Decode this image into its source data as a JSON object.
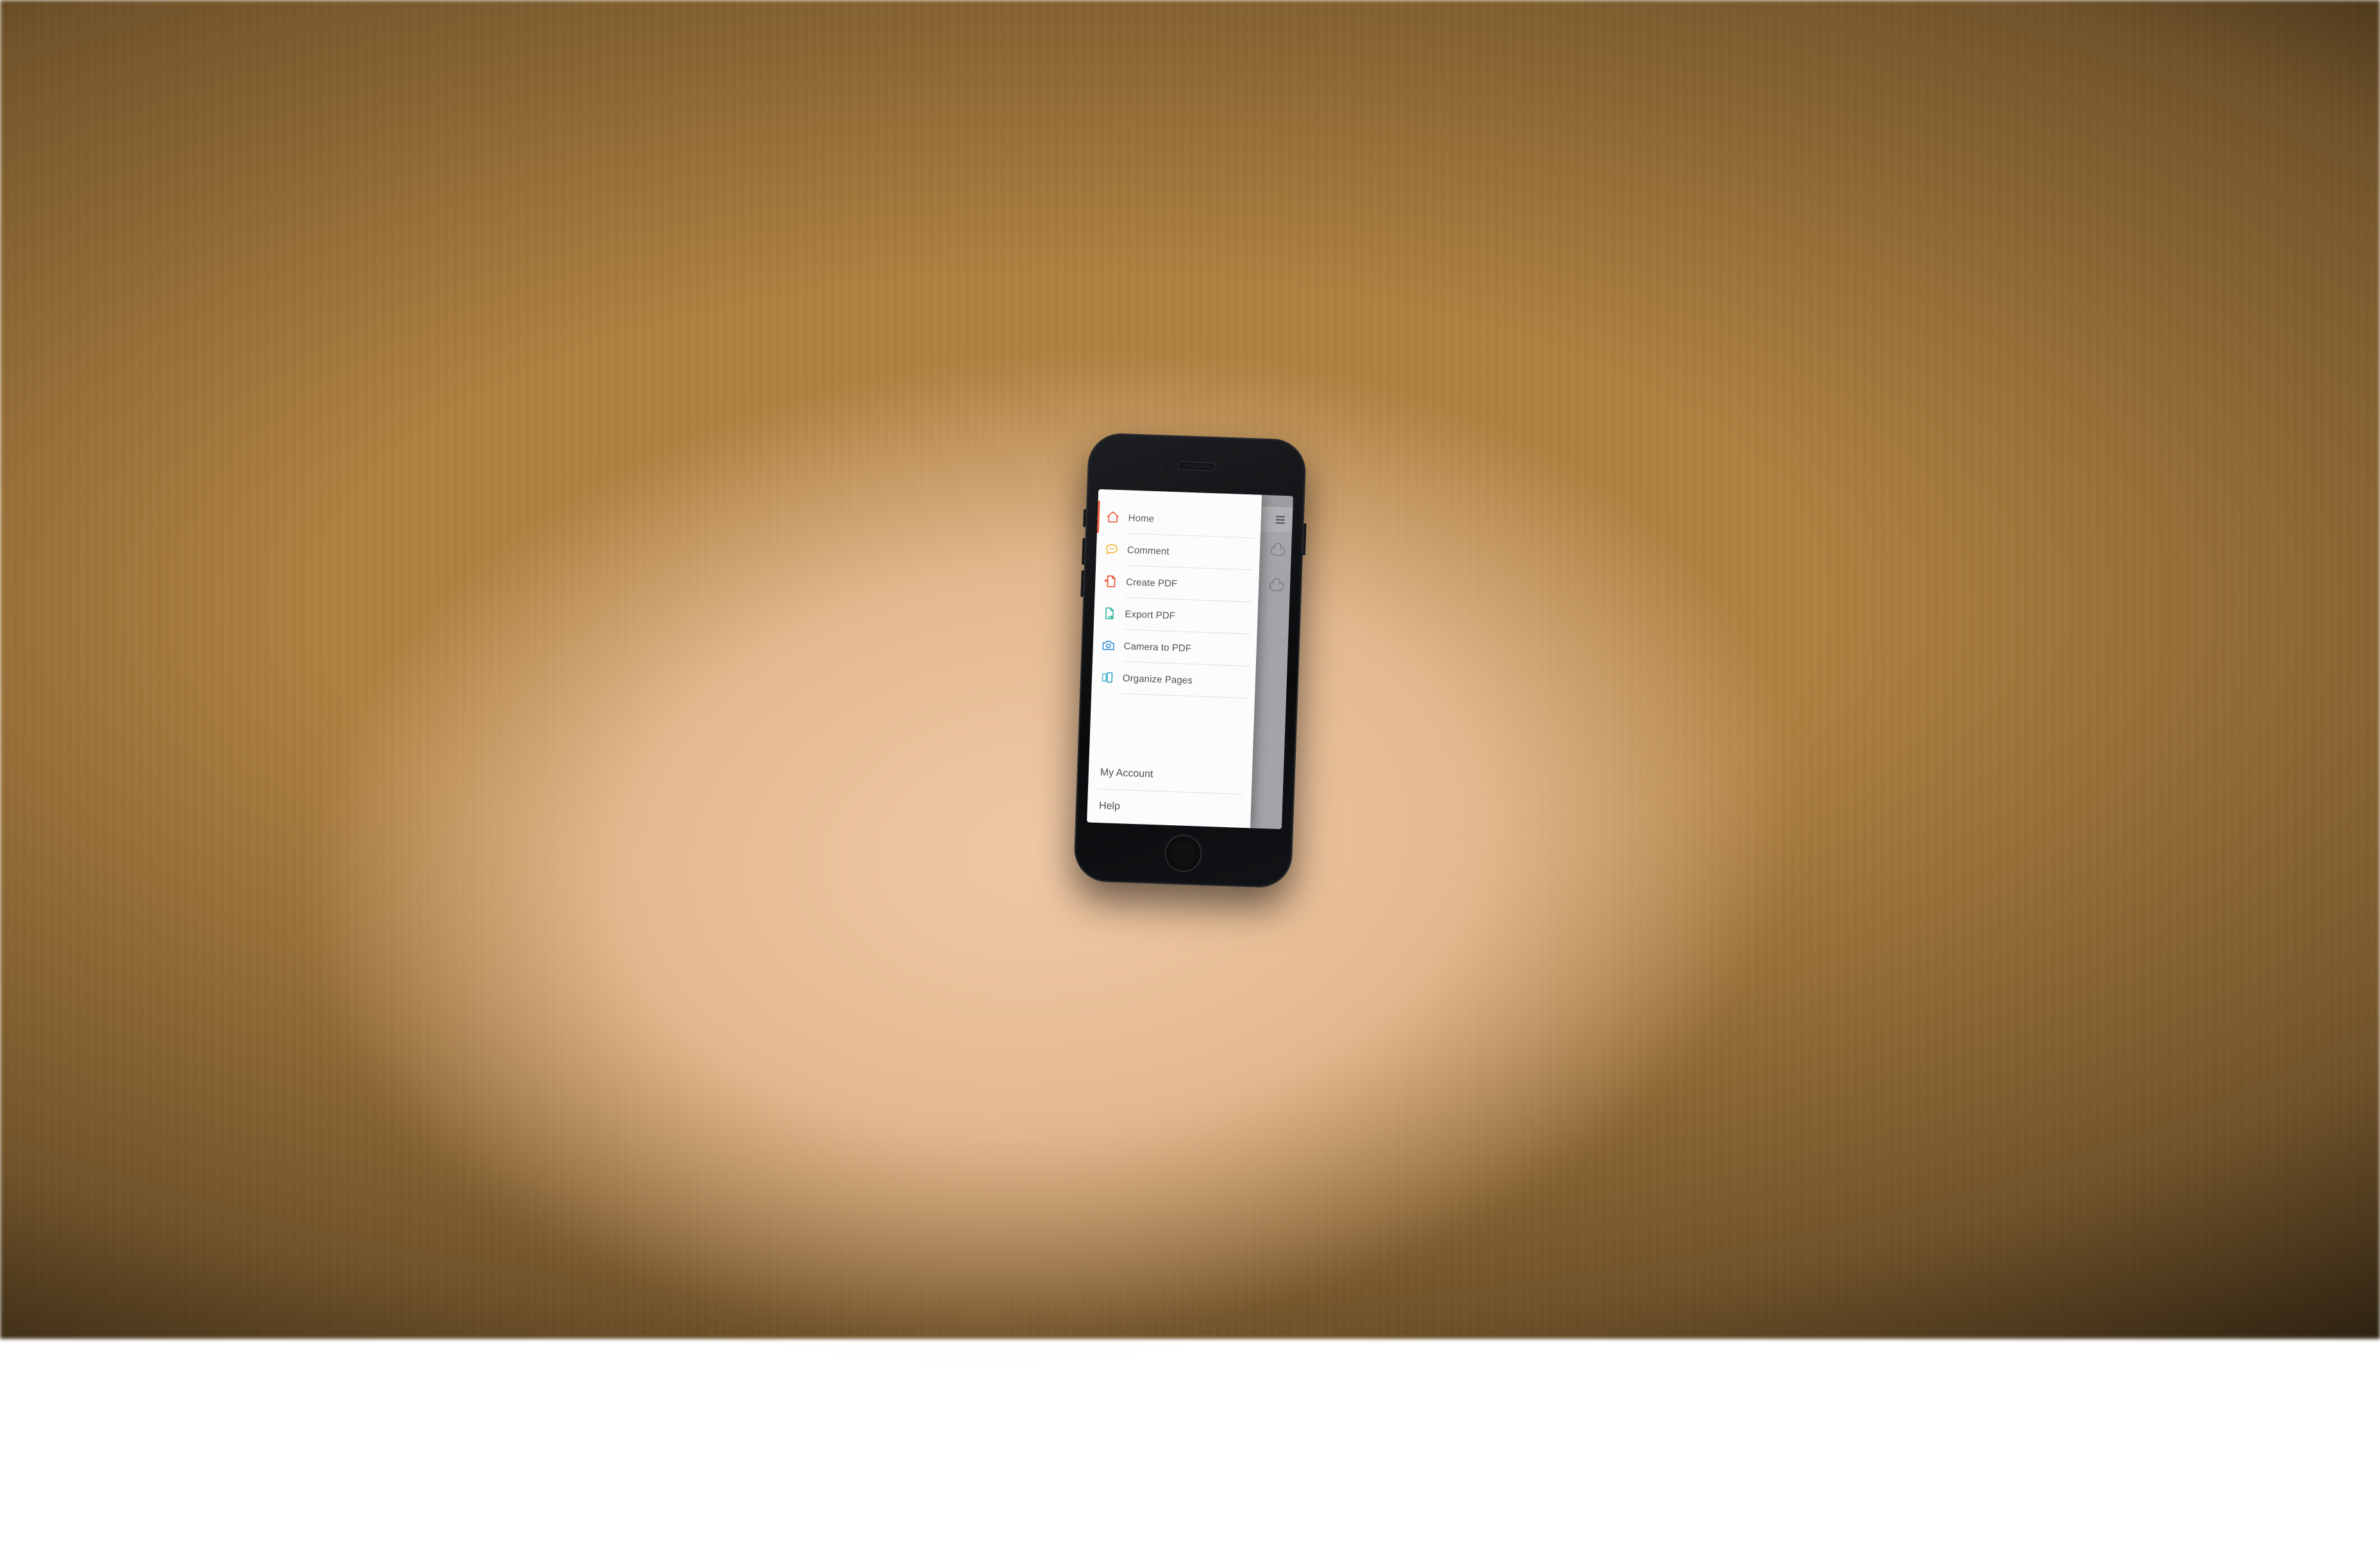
{
  "menu": {
    "items": [
      {
        "label": "Home",
        "icon": "home-icon",
        "color": "#e8451f",
        "active": true
      },
      {
        "label": "Comment",
        "icon": "comment-icon",
        "color": "#f2b21a",
        "active": false
      },
      {
        "label": "Create PDF",
        "icon": "file-plus-icon",
        "color": "#e8451f",
        "active": false
      },
      {
        "label": "Export PDF",
        "icon": "export-icon",
        "color": "#22b19b",
        "active": false
      },
      {
        "label": "Camera to PDF",
        "icon": "camera-icon",
        "color": "#2a8ad6",
        "active": false
      },
      {
        "label": "Organize Pages",
        "icon": "organize-icon",
        "color": "#2aa7c9",
        "active": false
      }
    ]
  },
  "footer": {
    "account_label": "My Account",
    "help_label": "Help"
  },
  "background_app": {
    "header_icon": "list-remove-icon",
    "row_icons": [
      "cloud-icon",
      "cloud-icon"
    ]
  }
}
